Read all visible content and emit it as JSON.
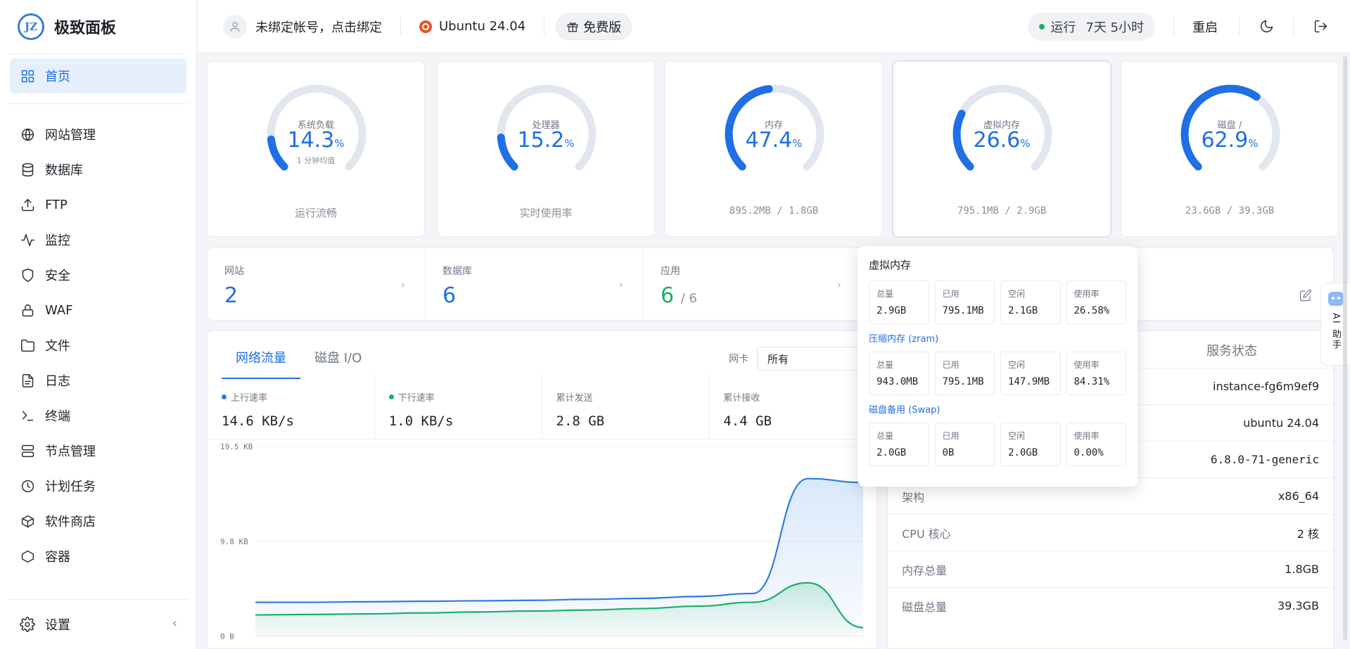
{
  "brand": {
    "logo_text": "JZ",
    "name": "极致面板"
  },
  "sidebar": {
    "items": [
      {
        "label": "首页",
        "icon": "grid-icon",
        "active": true
      },
      {
        "label": "网站管理",
        "icon": "globe-icon"
      },
      {
        "label": "数据库",
        "icon": "database-icon"
      },
      {
        "label": "FTP",
        "icon": "upload-icon"
      },
      {
        "label": "监控",
        "icon": "activity-icon"
      },
      {
        "label": "安全",
        "icon": "shield-icon"
      },
      {
        "label": "WAF",
        "icon": "lock-icon"
      },
      {
        "label": "文件",
        "icon": "folder-icon"
      },
      {
        "label": "日志",
        "icon": "log-icon"
      },
      {
        "label": "终端",
        "icon": "terminal-icon"
      },
      {
        "label": "节点管理",
        "icon": "server-icon"
      },
      {
        "label": "计划任务",
        "icon": "clock-icon"
      },
      {
        "label": "软件商店",
        "icon": "package-icon"
      },
      {
        "label": "容器",
        "icon": "hexagon-icon"
      }
    ],
    "settings_label": "设置",
    "collapse_glyph": "‹"
  },
  "header": {
    "account_text": "未绑定帐号，点击绑定",
    "os": "Ubuntu 24.04",
    "plan": "免费版",
    "uptime_label": "运行",
    "uptime_value": "7天  5小时",
    "restart_label": "重启"
  },
  "gauges": [
    {
      "label": "系统负载",
      "value": "14.3",
      "unit": "%",
      "percent": 14.3,
      "sub": "1 分钟均值",
      "footer": "运行流畅",
      "mono": false
    },
    {
      "label": "处理器",
      "value": "15.2",
      "unit": "%",
      "percent": 15.2,
      "sub": "",
      "footer": "实时使用率",
      "mono": false
    },
    {
      "label": "内存",
      "value": "47.4",
      "unit": "%",
      "percent": 47.4,
      "sub": "",
      "footer": "895.2MB / 1.8GB",
      "mono": true
    },
    {
      "label": "虚拟内存",
      "value": "26.6",
      "unit": "%",
      "percent": 26.6,
      "sub": "",
      "footer": "795.1MB / 2.9GB",
      "mono": true
    },
    {
      "label": "磁盘 /",
      "value": "62.9",
      "unit": "%",
      "percent": 62.9,
      "sub": "",
      "footer": "23.6GB / 39.3GB",
      "mono": true
    }
  ],
  "stats": {
    "sites": {
      "label": "网站",
      "value": "2"
    },
    "databases": {
      "label": "数据库",
      "value": "6"
    },
    "apps": {
      "label": "应用",
      "value": "6",
      "total": "/ 6"
    }
  },
  "traffic": {
    "tabs": [
      "网络流量",
      "磁盘 I/O"
    ],
    "nic_label": "网卡",
    "nic_value": "所有",
    "metrics": [
      {
        "label": "上行速率",
        "value": "14.6 KB/s",
        "color": "#2f7be6"
      },
      {
        "label": "下行速率",
        "value": "1.0 KB/s",
        "color": "#18b06b"
      },
      {
        "label": "累计发送",
        "value": "2.8 GB",
        "color": ""
      },
      {
        "label": "累计接收",
        "value": "4.4 GB",
        "color": ""
      }
    ]
  },
  "chart_data": {
    "type": "area",
    "y_ticks": [
      "19.5 KB",
      "9.8 KB",
      "0 B"
    ],
    "ylim": [
      0,
      19.5
    ],
    "y_unit": "KB",
    "x": [
      0,
      1,
      2,
      3,
      4,
      5,
      6,
      7,
      8,
      9,
      10,
      11
    ],
    "series": [
      {
        "color": "#2f7be6",
        "values": [
          3.5,
          3.5,
          3.55,
          3.6,
          3.65,
          3.7,
          3.8,
          3.9,
          4.1,
          4.4,
          16.2,
          15.8
        ]
      },
      {
        "color": "#18b06b",
        "values": [
          2.2,
          2.25,
          2.3,
          2.4,
          2.5,
          2.6,
          2.7,
          2.85,
          3.1,
          3.5,
          5.5,
          0.9
        ]
      }
    ]
  },
  "info": {
    "tab": "服务状态",
    "rows": [
      {
        "key": "",
        "value": "instance-fg6m9ef9",
        "mono": false
      },
      {
        "key": "",
        "value": "ubuntu 24.04",
        "mono": false
      },
      {
        "key": "",
        "value": "6.8.0-71-generic",
        "mono": true
      },
      {
        "key": "架构",
        "value": "x86_64",
        "mono": false
      },
      {
        "key": "CPU 核心",
        "value": "2 核",
        "mono": false
      },
      {
        "key": "内存总量",
        "value": "1.8GB",
        "mono": false
      },
      {
        "key": "磁盘总量",
        "value": "39.3GB",
        "mono": false
      }
    ]
  },
  "popover": {
    "title": "虚拟内存",
    "sections": [
      {
        "title": "",
        "cells": [
          {
            "label": "总量",
            "value": "2.9GB"
          },
          {
            "label": "已用",
            "value": "795.1MB"
          },
          {
            "label": "空闲",
            "value": "2.1GB"
          },
          {
            "label": "使用率",
            "value": "26.58%"
          }
        ]
      },
      {
        "title": "压缩内存 (zram)",
        "cells": [
          {
            "label": "总量",
            "value": "943.0MB"
          },
          {
            "label": "已用",
            "value": "795.1MB"
          },
          {
            "label": "空闲",
            "value": "147.9MB"
          },
          {
            "label": "使用率",
            "value": "84.31%"
          }
        ]
      },
      {
        "title": "磁盘备用 (Swap)",
        "cells": [
          {
            "label": "总量",
            "value": "2.0GB"
          },
          {
            "label": "已用",
            "value": "0B"
          },
          {
            "label": "空闲",
            "value": "2.0GB"
          },
          {
            "label": "使用率",
            "value": "0.00%"
          }
        ]
      }
    ]
  },
  "ai_helper": {
    "label": "AI 助手"
  },
  "colors": {
    "accent": "#1f6fe5",
    "gauge_track": "#e2e7ef",
    "green": "#18b06b"
  }
}
